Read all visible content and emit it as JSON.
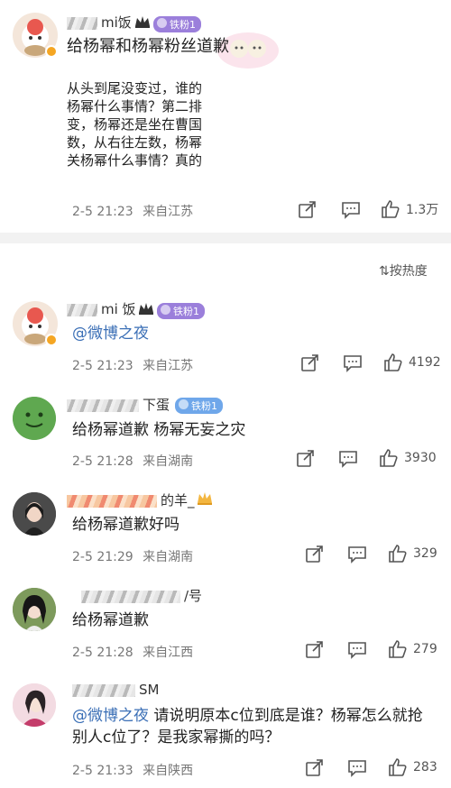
{
  "post": {
    "author_name": "mi饭",
    "author_badge": "铁粉1",
    "title": "给杨幂和杨幂粉丝道歉",
    "article_lines": [
      "从头到尾没变过，谁的",
      "杨幂什么事情？第二排",
      "变，杨幂还是坐在曹国",
      "数，从右往左数，杨幂",
      "关杨幂什么事情？真的"
    ],
    "time": "2-5 21:23",
    "source": "来自江苏",
    "likes": "1.3万"
  },
  "sort_label": "按热度",
  "comments": [
    {
      "name": "mi 饭",
      "badge": "铁粉1",
      "mention": "@微博之夜",
      "text": "",
      "time": "2-5 21:23",
      "source": "来自江苏",
      "likes": "4192"
    },
    {
      "name": "下蛋",
      "badge": "铁粉1",
      "mention": "",
      "text": "给杨幂道歉 杨幂无妄之灾",
      "time": "2-5 21:28",
      "source": "来自湖南",
      "likes": "3930"
    },
    {
      "name": "的羊_",
      "badge": "",
      "mention": "",
      "text": "给杨幂道歉好吗",
      "time": "2-5 21:29",
      "source": "来自湖南",
      "likes": "329"
    },
    {
      "name": "/号",
      "badge": "",
      "mention": "",
      "text": "给杨幂道歉",
      "time": "2-5 21:28",
      "source": "来自江西",
      "likes": "279"
    },
    {
      "name": "SM",
      "badge": "",
      "mention": "@微博之夜",
      "text": " 请说明原本c位到底是谁？杨幂怎么就抢别人c位了？是我家幂撕的吗？",
      "time": "2-5 21:33",
      "source": "来自陕西",
      "likes": "283"
    }
  ],
  "colors": {
    "badge_purple": "#9b7fdb",
    "badge_blue": "#6fa7ea",
    "mention": "#3b6fb6",
    "divider": "#f2f2f2"
  }
}
